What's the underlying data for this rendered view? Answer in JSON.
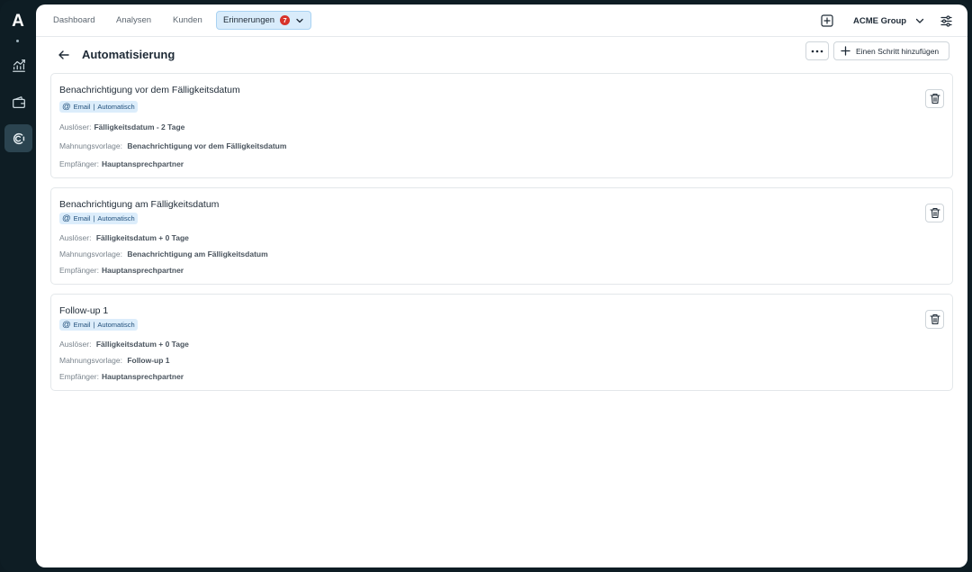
{
  "sidebar": {
    "logo": "A",
    "items": [
      {
        "icon": "chart-trend-icon"
      },
      {
        "icon": "wallet-icon"
      },
      {
        "icon": "reminder-icon",
        "active": true
      }
    ]
  },
  "nav": {
    "tabs": [
      {
        "label": "Dashboard"
      },
      {
        "label": "Analysen"
      },
      {
        "label": "Kunden"
      },
      {
        "label": "Erinnerungen",
        "badge": "7",
        "active": true
      }
    ],
    "org": "ACME Group"
  },
  "page": {
    "title": "Automatisierung",
    "add_step_label": "Einen Schritt hinzufügen"
  },
  "cards": [
    {
      "title": "Benachrichtigung vor dem Fälligkeitsdatum",
      "tag_channel": "Email",
      "tag_mode": "Automatisch",
      "trigger_label": "Auslöser:",
      "trigger_value": "Fälligkeitsdatum - 2 Tage",
      "template_label": "Mahnungsvorlage:",
      "template_value": "Benachrichtigung vor dem Fälligkeitsdatum",
      "recipient_label": "Empfänger:",
      "recipient_value": "Hauptansprechpartner"
    },
    {
      "title": "Benachrichtigung am Fälligkeitsdatum",
      "tag_channel": "Email",
      "tag_mode": "Automatisch",
      "trigger_label": "Auslöser:",
      "trigger_value": "Fälligkeitsdatum + 0 Tage",
      "template_label": "Mahnungsvorlage:",
      "template_value": "Benachrichtigung am Fälligkeitsdatum",
      "recipient_label": "Empfänger:",
      "recipient_value": "Hauptansprechpartner"
    },
    {
      "title": "Follow-up 1",
      "tag_channel": "Email",
      "tag_mode": "Automatisch",
      "trigger_label": "Auslöser:",
      "trigger_value": "Fälligkeitsdatum + 0 Tage",
      "template_label": "Mahnungsvorlage:",
      "template_value": "Follow-up 1",
      "recipient_label": "Empfänger:",
      "recipient_value": "Hauptansprechpartner"
    }
  ],
  "colors": {
    "accent": "#d9ecfb",
    "badge": "#d7322a",
    "sidebar_bg": "#0e1d24"
  }
}
